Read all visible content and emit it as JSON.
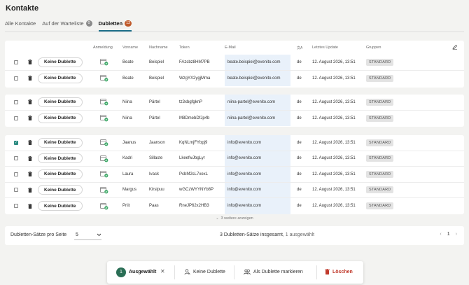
{
  "page": {
    "title": "Kontakte"
  },
  "tabs": [
    {
      "label": "Alle Kontakte",
      "count": ""
    },
    {
      "label": "Auf der Warteliste",
      "count": "0"
    },
    {
      "label": "Dubletten",
      "count": "12"
    }
  ],
  "table": {
    "columns": {
      "registration": "Anmeldung",
      "firstname": "Vorname",
      "lastname": "Nachname",
      "token": "Token",
      "email": "E-Mail",
      "language_icon": "translate-icon",
      "updated": "Letztes Update",
      "groups": "Gruppen"
    },
    "no_duplicate_label": "Keine Dublette",
    "groups": [
      [
        {
          "checked": false,
          "firstname": "Beate",
          "lastname": "Beispiel",
          "token": "FAzcbz8HM7PB",
          "email": "beate.beispiel@evenito.com",
          "lang": "de",
          "updated": "12. August 2026, 13:51",
          "group": "STANDARD"
        },
        {
          "checked": false,
          "firstname": "Beate",
          "lastname": "Beispiel",
          "token": "WzgYX2ygjMma",
          "email": "beate.beispiel@evenito.com",
          "lang": "de",
          "updated": "12. August 2026, 13:51",
          "group": "STANDARD"
        }
      ],
      [
        {
          "checked": false,
          "firstname": "Niina",
          "lastname": "Pärtel",
          "token": "tz3xbgfgknP",
          "email": "niina-partel@evenito.com",
          "lang": "de",
          "updated": "12. August 2026, 13:51",
          "group": "STANDARD"
        },
        {
          "checked": false,
          "firstname": "Niina",
          "lastname": "Pärtel",
          "token": "M8DmebDfJp4b",
          "email": "niina-partel@evenito.com",
          "lang": "de",
          "updated": "12. August 2026, 13:51",
          "group": "STANDARD"
        }
      ],
      [
        {
          "checked": true,
          "firstname": "Jaanus",
          "lastname": "Jaanson",
          "token": "KqNLmjFYbpj9",
          "email": "info@evenito.com",
          "lang": "de",
          "updated": "12. August 2026, 13:51",
          "group": "STANDARD"
        },
        {
          "checked": false,
          "firstname": "Kadri",
          "lastname": "Sillaste",
          "token": "LkeefwJbgLyr",
          "email": "info@evenito.com",
          "lang": "de",
          "updated": "12. August 2026, 13:51",
          "group": "STANDARD"
        },
        {
          "checked": false,
          "firstname": "Laura",
          "lastname": "Ivask",
          "token": "PcbM2sL7xexL",
          "email": "info@evenito.com",
          "lang": "de",
          "updated": "12. August 2026, 13:51",
          "group": "STANDARD"
        },
        {
          "checked": false,
          "firstname": "Margus",
          "lastname": "Kirsipuu",
          "token": "wGCzWYYNYb8P",
          "email": "info@evenito.com",
          "lang": "de",
          "updated": "12. August 2026, 13:51",
          "group": "STANDARD"
        },
        {
          "checked": false,
          "firstname": "Priit",
          "lastname": "Paas",
          "token": "RneJP62x2HB3",
          "email": "info@evenito.com",
          "lang": "de",
          "updated": "12. August 2026, 13:51",
          "group": "STANDARD"
        }
      ]
    ],
    "show_more": "3 weitere anzeigen"
  },
  "footer": {
    "per_page_label": "Dubletten-Sätze pro Seite",
    "per_page_value": "5",
    "total": "3 Dubletten-Sätze insgesamt",
    "selected": ", 1 ausgewählt",
    "page": "1"
  },
  "action_bar": {
    "count": "1",
    "selected_label": "Ausgewählt",
    "no_duplicate": "Keine Dublette",
    "mark_duplicate": "Als Dublette markieren",
    "delete": "Löschen"
  },
  "colors": {
    "accent": "#1e6f8a",
    "badge_dubletten": "#c05a2b",
    "check": "#2a8a80",
    "danger": "#c0392b",
    "email_bg": "#e9f1fa"
  }
}
